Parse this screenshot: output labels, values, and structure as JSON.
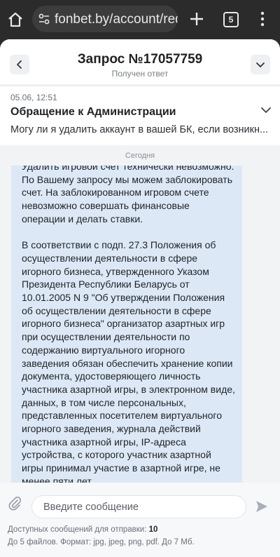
{
  "browser": {
    "url": "fonbet.by/account/requ",
    "tab_count": "5"
  },
  "header": {
    "title": "Запрос №17057759",
    "subtitle": "Получен ответ"
  },
  "ticket": {
    "date": "05.06, 12:51",
    "subject": "Обращение к Администрации",
    "preview": "Могу ли я удалить аккаунт в вашей БК, если возникн..."
  },
  "chat": {
    "day_separator": "Сегодня",
    "message": {
      "paragraph_1": "Удалить игровой счет технически невозможно. По Вашему запросу мы можем заблокировать счет. На заблокированном игровом счете невозможно совершать финансовые операции и делать ставки.",
      "paragraph_2": "В соответствии с подп. 27.3 Положения об осуществлении деятельности в сфере игорного бизнеса, утвержденного Указом Президента Республики Беларусь от 10.01.2005 N 9 \"Об утверждении Положения об осуществлении деятельности в сфере игорного бизнеса\" организатор азартных игр при осуществлении деятельности по содержанию виртуального игорного заведения обязан обеспечить хранение копии документа, удостоверяющего личность участника азартной игры, в электронном виде, данных, в том числе персональных, представленных посетителем виртуального игорного заведения, журнала действий участника азартной игры, IP-адреса устройства, с которого участник азартной игры принимал участие в азартной игре, не менее пяти лет"
    }
  },
  "composer": {
    "placeholder": "Введите сообщение",
    "quota_label": "Доступных сообщений для отправки:",
    "quota_value": "10",
    "formats_hint": "До 5 файлов. Формат: jpg, jpeg, png, pdf. До 7 Мб."
  },
  "icons": {
    "home": "home-icon",
    "site_settings": "tune-icon",
    "new_tab": "plus-icon",
    "tabs": "tab-switcher-icon",
    "menu": "more-vert-icon",
    "back": "chevron-left-icon",
    "collapse": "chevron-down-icon",
    "attach": "paperclip-icon",
    "send": "send-icon"
  },
  "colors": {
    "bubble": "#dce8f6",
    "sheet": "#f2f3f5",
    "chrome": "#2b2b2b"
  }
}
